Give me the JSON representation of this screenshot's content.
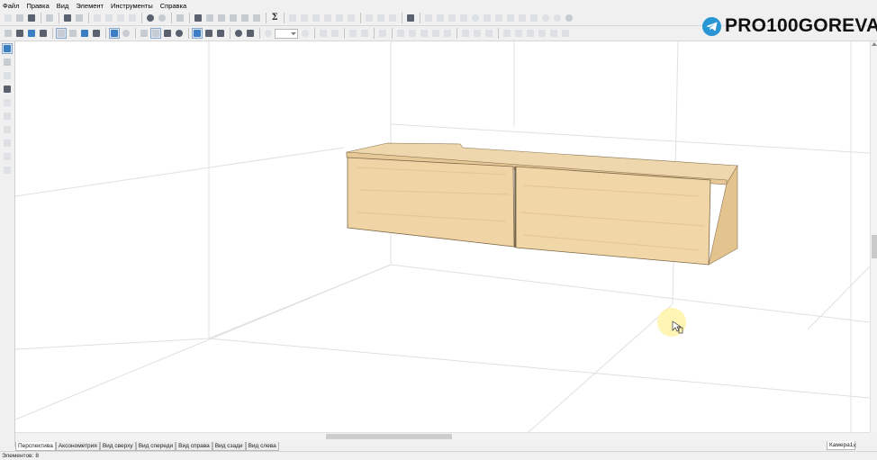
{
  "menu": {
    "items": [
      "Файл",
      "Правка",
      "Вид",
      "Элемент",
      "Инструменты",
      "Справка"
    ]
  },
  "toolbar_top": {
    "sigma_symbol": "Σ"
  },
  "logo": {
    "text": "PRO100GOREVA",
    "icon": "telegram-icon",
    "color": "#2a95d4"
  },
  "view_tabs": [
    "Перспектива",
    "Аксонометрия",
    "Вид сверху",
    "Вид спереди",
    "Вид справа",
    "Вид сзади",
    "Вид слева"
  ],
  "camera_tab": {
    "label": "Камера1",
    "close": "×"
  },
  "status": {
    "label": "Элементов:",
    "count": "8"
  },
  "colors": {
    "wood": "#eed2a4",
    "wood_dark": "#d9b781",
    "cursor_highlight": "#fff3a8",
    "grid": "#dedede"
  }
}
